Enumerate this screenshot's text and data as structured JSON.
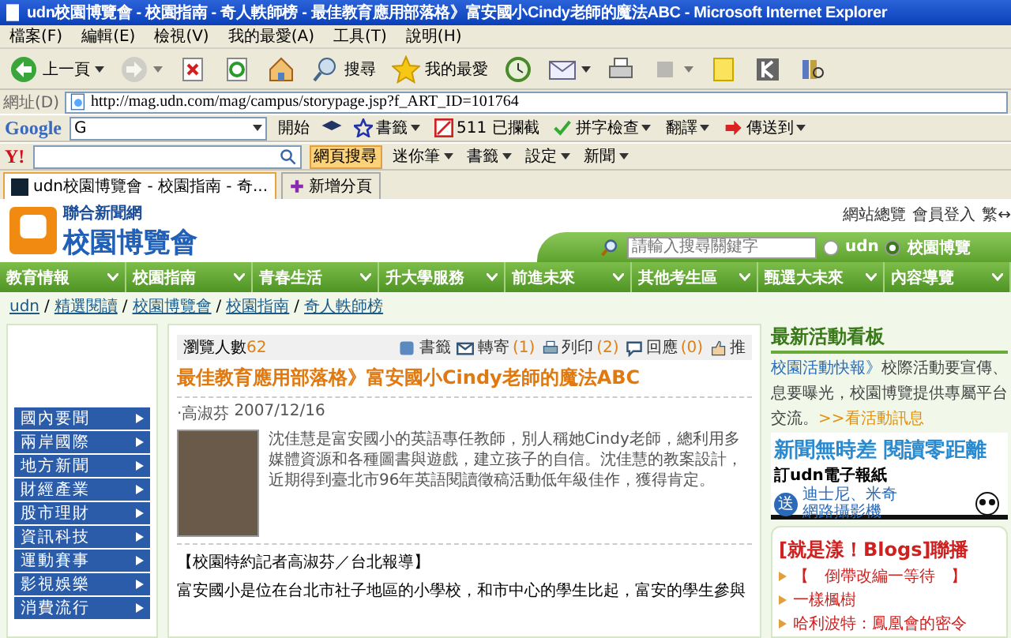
{
  "window": {
    "title": "udn校園博覽會 - 校園指南 - 奇人軼師榜 - 最佳教育應用部落格》富安國小Cindy老師的魔法ABC - Microsoft Internet Explorer"
  },
  "menu": [
    "檔案(F)",
    "編輯(E)",
    "檢視(V)",
    "我的最愛(A)",
    "工具(T)",
    "說明(H)"
  ],
  "toolbar": [
    {
      "kind": "back",
      "label": "上一頁",
      "caret": true,
      "disabled": false
    },
    {
      "kind": "forward",
      "caret": true,
      "disabled": true
    },
    {
      "kind": "stop",
      "caret": false,
      "disabled": false
    },
    {
      "kind": "refresh",
      "caret": false,
      "disabled": false
    },
    {
      "kind": "home",
      "caret": false,
      "disabled": false
    },
    {
      "kind": "search",
      "label": "搜尋",
      "caret": false,
      "disabled": false
    },
    {
      "kind": "favorites",
      "label": "我的最愛",
      "caret": false,
      "disabled": false
    },
    {
      "kind": "history",
      "caret": false,
      "disabled": false
    },
    {
      "kind": "mail",
      "caret": true,
      "disabled": false
    },
    {
      "kind": "print",
      "caret": false,
      "disabled": false
    },
    {
      "kind": "edit",
      "caret": true,
      "disabled": true
    },
    {
      "kind": "note",
      "caret": false,
      "disabled": false
    },
    {
      "kind": "k",
      "caret": false,
      "disabled": false
    },
    {
      "kind": "research",
      "caret": false,
      "disabled": false
    }
  ],
  "address": {
    "label": "網址(D)",
    "value": "http://mag.udn.com/mag/campus/storypage.jsp?f_ART_ID=101764"
  },
  "google_bar": {
    "logo": "Google",
    "field_prefix": "G",
    "go": "開始",
    "bookmarks": "書籤",
    "blocked": "511 已攔截",
    "spell": "拼字檢查",
    "translate": "翻譯",
    "send": "傳送到"
  },
  "yahoo_bar": {
    "logo": "Y!",
    "search_button": "網頁搜尋",
    "notes": "迷你筆",
    "bookmarks": "書籤",
    "settings": "設定",
    "news": "新聞"
  },
  "tabs": [
    {
      "label": "udn校園博覽會 - 校園指南 - 奇...",
      "selected": true
    },
    {
      "label": "新增分頁",
      "selected": false
    }
  ],
  "site": {
    "logo_sub": "聯合新聞網",
    "logo_title": "校園博覽會",
    "top_links": [
      "網站總覽",
      "會員登入",
      "繁↔"
    ],
    "search": {
      "placeholder": "請輸入搜尋關鍵字"
    },
    "scopes": [
      {
        "label": "udn",
        "selected": false
      },
      {
        "label": "校園博覽",
        "selected": true
      }
    ],
    "nav": [
      "教育情報",
      "校園指南",
      "青春生活",
      "升大學服務",
      "前進未來",
      "其他考生區",
      "甄選大未來",
      "內容導覽"
    ],
    "breadcrumb_separator": "/",
    "breadcrumb": [
      "udn",
      "精選閱讀",
      "校園博覽會",
      "校園指南",
      "奇人軼師榜"
    ],
    "side_nav": [
      "國內要聞",
      "兩岸國際",
      "地方新聞",
      "財經產業",
      "股市理財",
      "資訊科技",
      "運動賽事",
      "影視娛樂",
      "消費流行"
    ]
  },
  "article": {
    "views_label": "瀏覽人數",
    "views": "62",
    "actions": [
      {
        "kind": "bookmark",
        "label": "書籤"
      },
      {
        "kind": "envelope",
        "label": "轉寄",
        "count": "(1)"
      },
      {
        "kind": "printer",
        "label": "列印",
        "count": "(2)"
      },
      {
        "kind": "speech",
        "label": "回應",
        "count": "(0)"
      },
      {
        "kind": "thumb",
        "label": "推"
      }
    ],
    "title": "最佳教育應用部落格》富安國小Cindy老師的魔法ABC",
    "author": "‧高淑芬",
    "date": "2007/12/16",
    "summary": "沈佳慧是富安國小的英語專任教師，別人稱她Cindy老師，總利用多媒體資源和各種圖書與遊戲，建立孩子的自信。沈佳慧的教案設計，近期得到臺北市96年英語閱讀徵稿活動低年級佳作，獲得肯定。",
    "lead": "【校園特約記者高淑芬／台北報導】",
    "body": "富安國小是位在台北市社子地區的小學校，和市中心的學生比起，富安的學生參與"
  },
  "sidebar": {
    "heading": "最新活動看板",
    "lines": [
      {
        "link": "校園活動快報》",
        "text": "校際活動要宣傳、"
      },
      {
        "text": "息要曝光，校園博覽提供專屬平台"
      },
      {
        "text": "交流。",
        "link": ">>看活動訊息"
      }
    ],
    "ad": {
      "headline": "新聞無時差 閱讀零距離",
      "sub": "訂udn電子報紙",
      "badge": "送",
      "gift_1": "迪士尼、米奇",
      "gift_2": "網路攝影機"
    },
    "blog_heading": "[就是漾！Blogs]聯播",
    "blogs": [
      "【　倒帶改編一等待　】",
      "一樣楓樹",
      "哈利波特：鳳凰會的密令"
    ]
  }
}
